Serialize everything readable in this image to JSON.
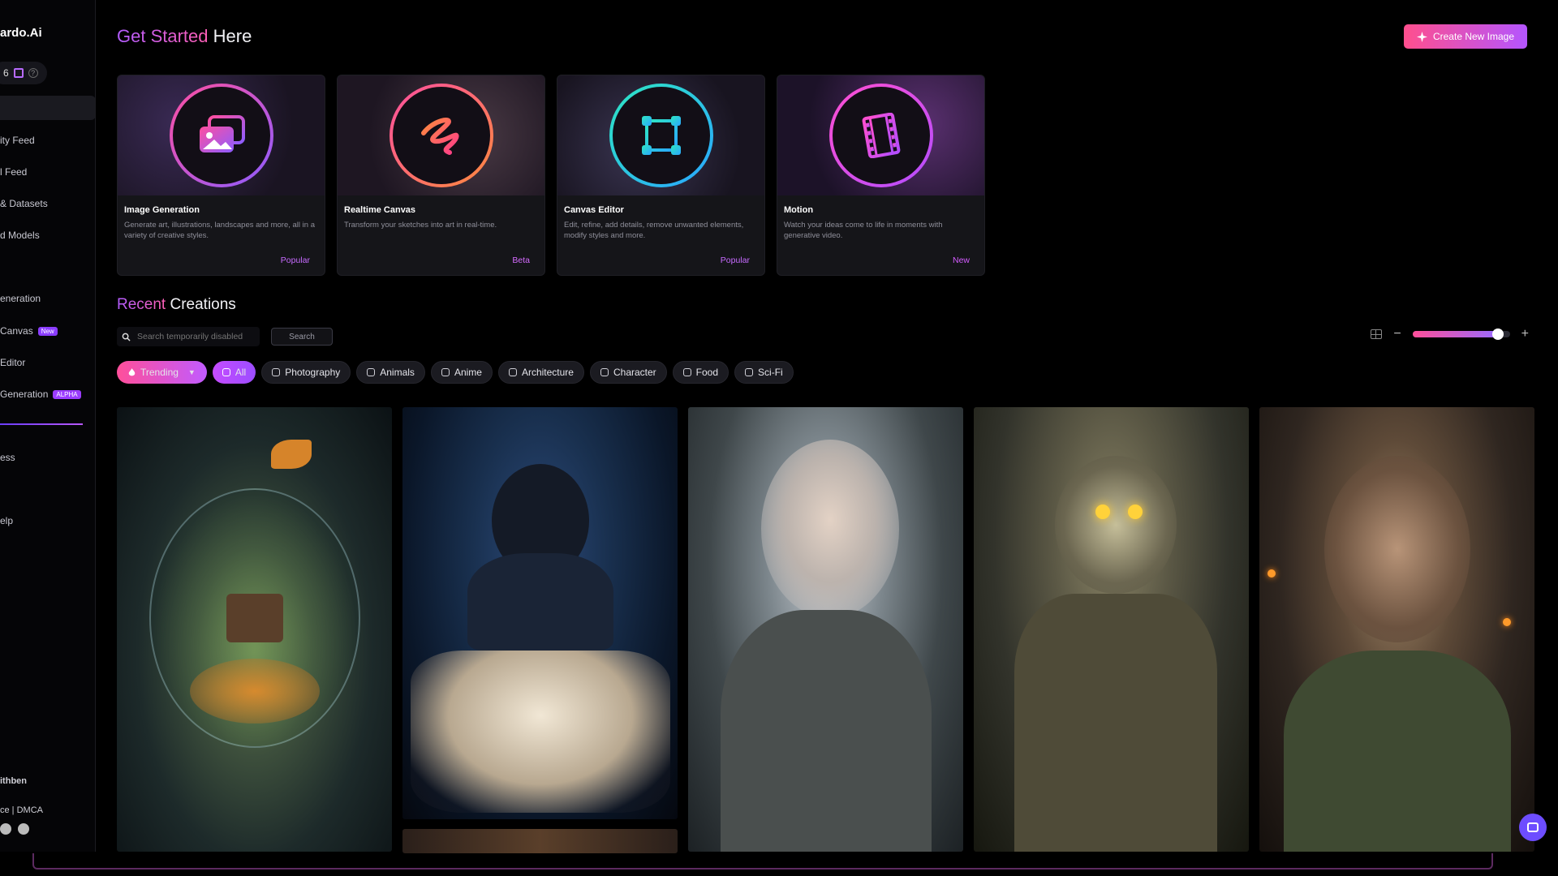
{
  "sidebar": {
    "brand": "ardo.Ai",
    "tokens": "6",
    "items": [
      {
        "label": "ity Feed",
        "badge": ""
      },
      {
        "label": "l Feed",
        "badge": ""
      },
      {
        "label": "& Datasets",
        "badge": ""
      },
      {
        "label": "d Models",
        "badge": ""
      },
      {
        "label": "eneration",
        "badge": ""
      },
      {
        "label": "Canvas",
        "badge": "New"
      },
      {
        "label": "Editor",
        "badge": ""
      },
      {
        "label": "Generation",
        "badge": "ALPHA"
      },
      {
        "label": "ess",
        "badge": ""
      },
      {
        "label": "elp",
        "badge": ""
      }
    ],
    "footer_user": "ithben",
    "footer_links": "ce | DMCA"
  },
  "header": {
    "title_accent": "Get Started",
    "title_rest": " Here",
    "create_button": "Create New Image"
  },
  "tools": [
    {
      "title": "Image Generation",
      "desc": "Generate art, illustrations, landscapes and more, all in a variety of creative styles.",
      "tag": "Popular",
      "icon": "image-stack-icon"
    },
    {
      "title": "Realtime Canvas",
      "desc": "Transform your sketches into art in real-time.",
      "tag": "Beta",
      "icon": "brush-stroke-icon"
    },
    {
      "title": "Canvas Editor",
      "desc": "Edit, refine, add details, remove unwanted elements, modify styles and more.",
      "tag": "Popular",
      "icon": "bounding-box-icon"
    },
    {
      "title": "Motion",
      "desc": "Watch your ideas come to life in moments with generative video.",
      "tag": "New",
      "icon": "film-strip-icon"
    }
  ],
  "recent": {
    "title_accent": "Recent",
    "title_rest": " Creations",
    "search_placeholder": "Search temporarily disabled",
    "search_button": "Search",
    "zoom_level": 0.88
  },
  "filters": [
    "Trending",
    "All",
    "Photography",
    "Animals",
    "Anime",
    "Architecture",
    "Character",
    "Food",
    "Sci-Fi"
  ],
  "colors": {
    "accent_pink": "#ff4f9a",
    "accent_purple": "#b455ff"
  }
}
